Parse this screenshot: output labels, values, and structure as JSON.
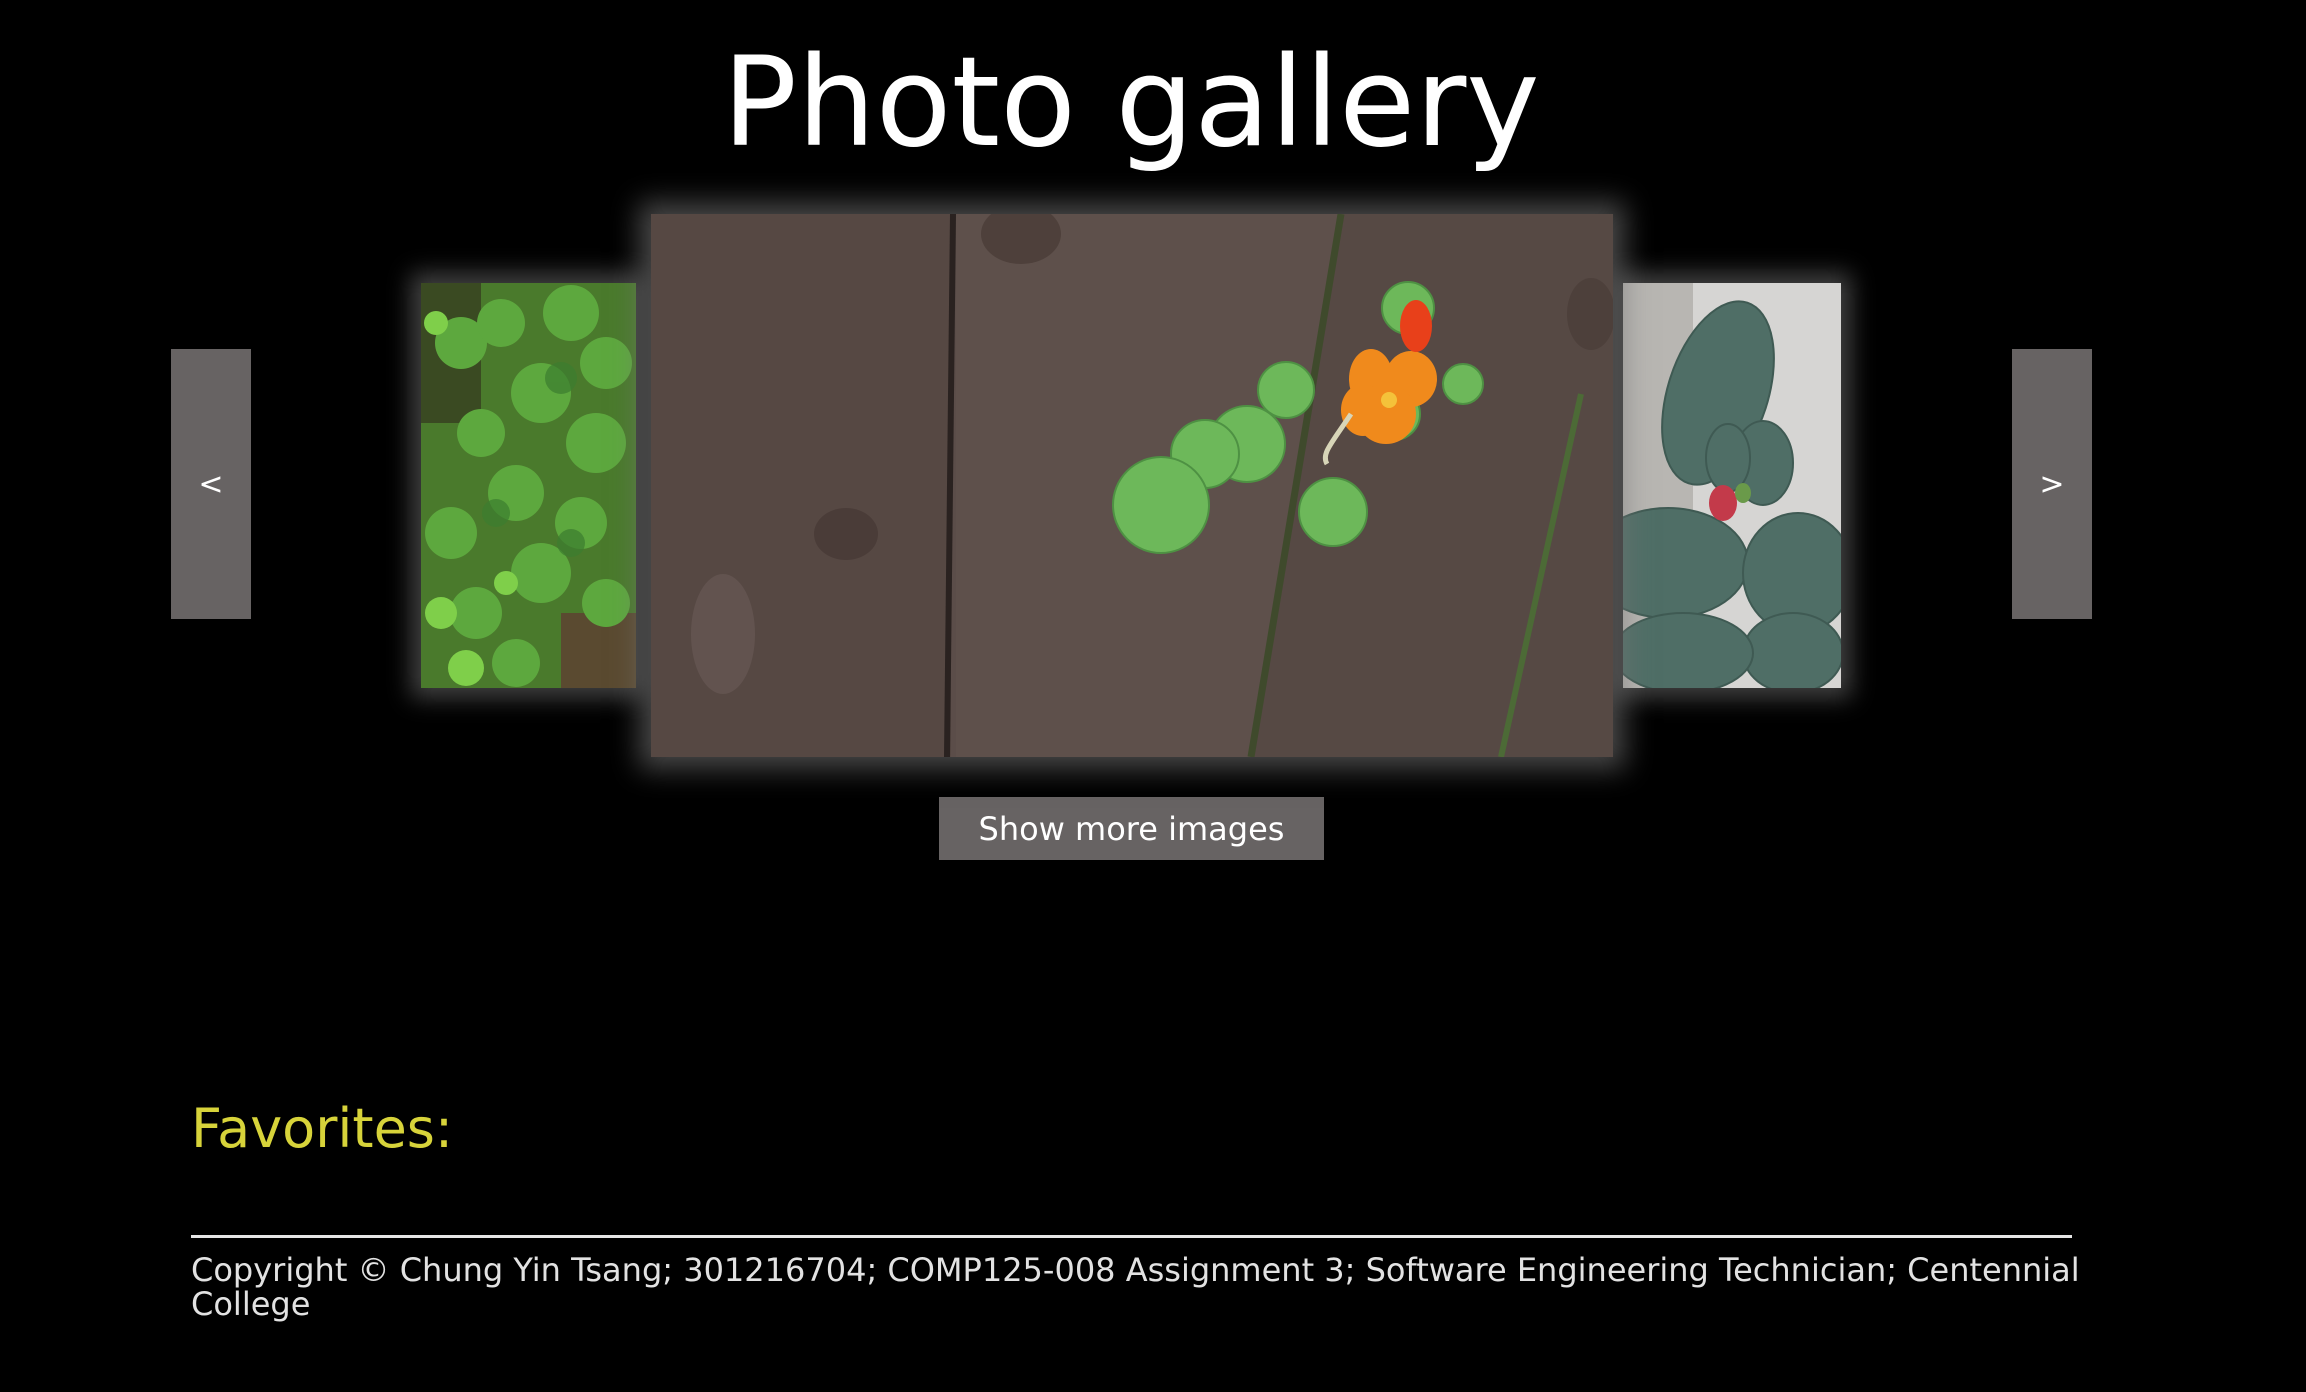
{
  "header": {
    "title": "Photo gallery"
  },
  "carousel": {
    "prev_label": "<",
    "next_label": ">",
    "images": [
      {
        "position": "left",
        "subject": "clover plants"
      },
      {
        "position": "center",
        "subject": "nasturtium on wooden fence"
      },
      {
        "position": "right",
        "subject": "prickly pear cactus"
      }
    ]
  },
  "actions": {
    "show_more_label": "Show more images"
  },
  "favorites": {
    "heading": "Favorites:"
  },
  "footer": {
    "copyright": "Copyright © Chung Yin Tsang; 301216704; COMP125-008 Assignment 3; Software Engineering Technician; Centennial College"
  },
  "colors": {
    "background": "#000000",
    "button": "#676363",
    "favorites_heading": "#d7d33a"
  }
}
